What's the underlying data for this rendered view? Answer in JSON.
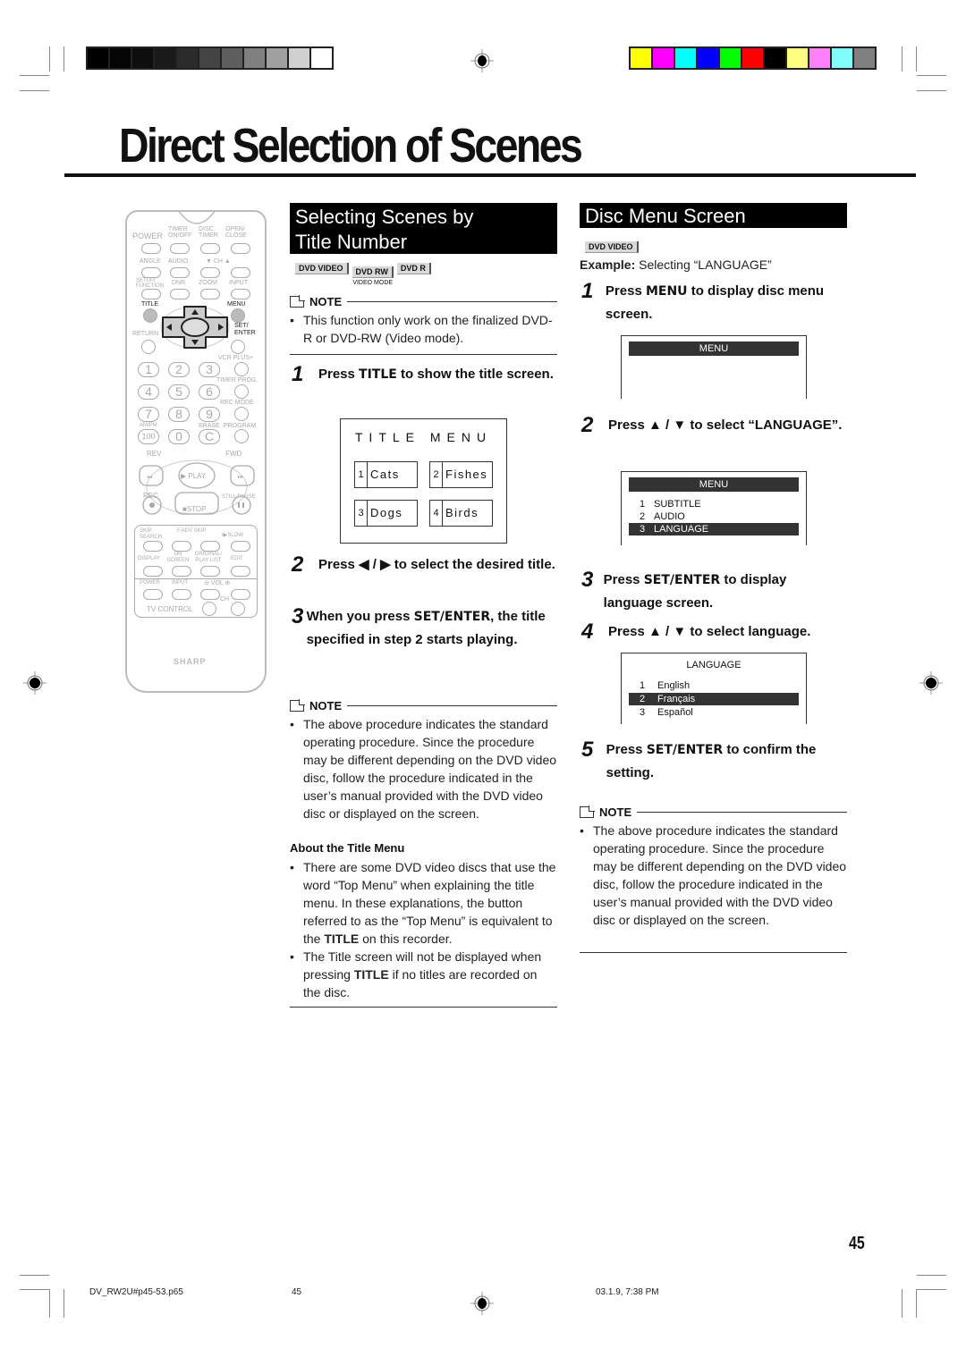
{
  "print_marks": {
    "grayscale_bar": [
      "#000000",
      "#050505",
      "#0e0e0e",
      "#1a1a1a",
      "#2b2b2b",
      "#444444",
      "#5e5e5e",
      "#808080",
      "#a0a0a0",
      "#d0d0d0",
      "#ffffff"
    ],
    "color_bar": [
      "#ffff00",
      "#ff00ff",
      "#00ffff",
      "#0000ff",
      "#00ff00",
      "#ff0000",
      "#000000",
      "#ffff80",
      "#ff80ff",
      "#80ffff",
      "#808080"
    ]
  },
  "page": {
    "title": "Direct Selection of Scenes",
    "page_number": "45"
  },
  "remote": {
    "brand": "SHARP",
    "row1": [
      "POWER",
      "TIMER ON/OFF",
      "DISC TIMER",
      "OPEN/ CLOSE"
    ],
    "row2": [
      "ANGLE",
      "AUDIO",
      "▼ CH ▲"
    ],
    "row3": [
      "SETUP/ FUNCTION",
      "DNR",
      "ZOOM",
      "INPUT"
    ],
    "title_label": "TITLE",
    "menu_label": "MENU",
    "set_enter_label": "SET/ ENTER",
    "return_label": "RETURN",
    "vcr_plus_label": "VCR PLUS+",
    "timer_prog_label": "TIMER PROG.",
    "rec_mode_label": "REC MODE",
    "ampm_label": "AM/PM",
    "erase_label": "ERASE",
    "program_label": "PROGRAM",
    "numbers": [
      "1",
      "2",
      "3",
      "4",
      "5",
      "6",
      "7",
      "8",
      "9",
      "100",
      "0",
      "C"
    ],
    "rev_label": "REV",
    "fwd_label": "FWD",
    "play_label": "▶ PLAY",
    "rec_label": "REC",
    "still_pause_label": "STILL/PAUSE",
    "stop_label": "■STOP",
    "row_skip": [
      "SKIP SEARCH",
      "F.ADV SKIP",
      "I▶SLOW"
    ],
    "row_display": [
      "DISPLAY",
      "ON SCREEN",
      "ORIGINAL/ PLAY LIST",
      "EDIT"
    ],
    "row_tv": [
      "POWER",
      "INPUT",
      "⊖ VOL ⊕"
    ],
    "tv_control_label": "TV CONTROL",
    "ch_label": "CH"
  },
  "left_section": {
    "heading_line1": "Selecting Scenes by",
    "heading_line2": "Title Number",
    "badges": [
      "DVD VIDEO",
      "DVD RW",
      "DVD R"
    ],
    "badge_sub": "VIDEO MODE",
    "note_label": "NOTE",
    "note1": "This function only work on the finalized DVD-R or DVD-RW (Video mode).",
    "steps": [
      {
        "num": "1",
        "pre": "Press ",
        "kw": "TITLE",
        "post": " to show the title screen."
      },
      {
        "num": "2",
        "text": "Press ◀ / ▶ to select the desired title."
      },
      {
        "num": "3",
        "pre": "When you press ",
        "kw": "SET/ENTER",
        "post": ", the title specified in step 2 starts playing."
      }
    ],
    "title_menu": {
      "heading": "TITLE MENU",
      "items": [
        {
          "n": "1",
          "label": "Cats"
        },
        {
          "n": "2",
          "label": "Fishes"
        },
        {
          "n": "3",
          "label": "Dogs"
        },
        {
          "n": "4",
          "label": "Birds"
        }
      ]
    },
    "note2_label": "NOTE",
    "note2": "The above procedure indicates the standard operating procedure. Since the procedure may be different depending on the DVD video disc, follow the procedure indicated in the user’s manual provided with the DVD video disc or displayed on the screen.",
    "about_heading": "About the Title Menu",
    "about_bullet1_pre": "There are some DVD video discs that use the word “Top Menu” when explaining the title menu. In these explanations, the button referred to as the “Top Menu” is equivalent to the ",
    "about_bullet1_kw": "TITLE",
    "about_bullet1_post": " on this recorder.",
    "about_bullet2_pre": "The Title screen will not be displayed when pressing ",
    "about_bullet2_kw": "TITLE",
    "about_bullet2_post": " if no titles are recorded on the disc."
  },
  "right_section": {
    "heading": "Disc Menu Screen",
    "badge": "DVD VIDEO",
    "example_label": "Example:",
    "example_text": " Selecting “LANGUAGE”",
    "steps": [
      {
        "num": "1",
        "pre": "Press ",
        "kw": "MENU",
        "post": " to display disc menu screen."
      },
      {
        "num": "2",
        "text": "Press ▲ / ▼ to select “LANGUAGE”."
      },
      {
        "num": "3",
        "pre": "Press ",
        "kw": "SET/ENTER",
        "post": " to display language screen."
      },
      {
        "num": "4",
        "text": "Press ▲ / ▼ to select language."
      },
      {
        "num": "5",
        "pre": "Press ",
        "kw": "SET/ENTER",
        "post": " to confirm the setting."
      }
    ],
    "menu_screen1": {
      "title": "MENU"
    },
    "menu_screen2": {
      "title": "MENU",
      "items": [
        {
          "n": "1",
          "label": "SUBTITLE",
          "selected": false
        },
        {
          "n": "2",
          "label": "AUDIO",
          "selected": false
        },
        {
          "n": "3",
          "label": "LANGUAGE",
          "selected": true
        }
      ]
    },
    "language_screen": {
      "title": "LANGUAGE",
      "items": [
        {
          "n": "1",
          "label": "English",
          "selected": false
        },
        {
          "n": "2",
          "label": "Français",
          "selected": true
        },
        {
          "n": "3",
          "label": "Español",
          "selected": false
        }
      ]
    },
    "note_label": "NOTE",
    "note": "The above procedure indicates the standard operating procedure. Since the procedure may be different depending on the DVD video disc, follow the procedure indicated in the user’s manual provided with the DVD video disc or displayed on the screen."
  },
  "footer": {
    "filename": "DV_RW2U#p45-53.p65",
    "page": "45",
    "timestamp": "03.1.9, 7:38 PM"
  }
}
